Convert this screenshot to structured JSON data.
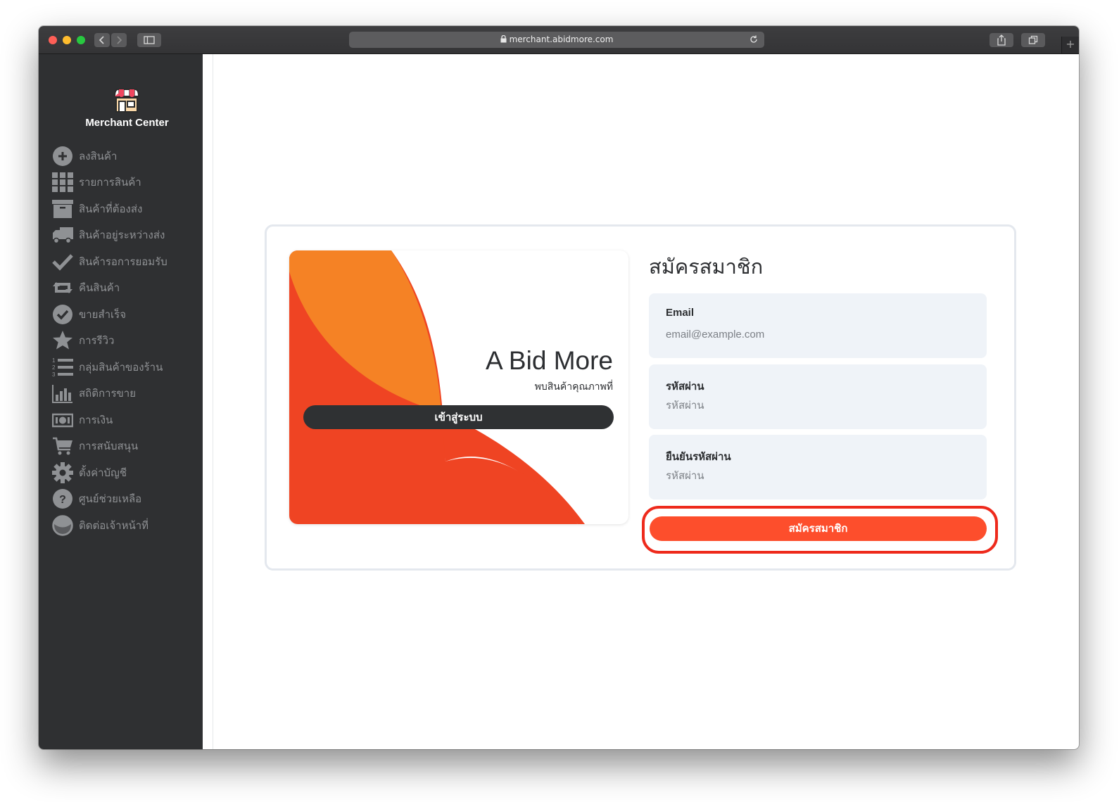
{
  "browser": {
    "url": "merchant.abidmore.com"
  },
  "sidebar": {
    "brand": "Merchant Center",
    "items": [
      {
        "label": "ลงสินค้า",
        "icon": "add-circle-icon"
      },
      {
        "label": "รายการสินค้า",
        "icon": "grid-icon"
      },
      {
        "label": "สินค้าที่ต้องส่ง",
        "icon": "archive-box-icon"
      },
      {
        "label": "สินค้าอยู่ระหว่างส่ง",
        "icon": "truck-icon"
      },
      {
        "label": "สินค้ารอการยอมรับ",
        "icon": "checkmark-icon"
      },
      {
        "label": "คืนสินค้า",
        "icon": "return-arrows-icon"
      },
      {
        "label": "ขายสำเร็จ",
        "icon": "check-circle-icon"
      },
      {
        "label": "การรีวิว",
        "icon": "star-icon"
      },
      {
        "label": "กลุ่มสินค้าของร้าน",
        "icon": "numbered-list-icon"
      },
      {
        "label": "สถิติการขาย",
        "icon": "bar-chart-icon"
      },
      {
        "label": "การเงิน",
        "icon": "money-icon"
      },
      {
        "label": "การสนับสนุน",
        "icon": "cart-icon"
      },
      {
        "label": "ตั้งค่าบัญชี",
        "icon": "gear-icon"
      },
      {
        "label": "ศูนย์ช่วยเหลือ",
        "icon": "help-icon"
      },
      {
        "label": "ติดต่อเจ้าหน้าที่",
        "icon": "chat-icon"
      }
    ]
  },
  "promo": {
    "title": "A Bid More",
    "subtitle": "พบสินค้าคุณภาพที่",
    "login_button": "เข้าสู่ระบบ"
  },
  "form": {
    "title": "สมัครสมาชิก",
    "email_label": "Email",
    "email_placeholder": "email@example.com",
    "password_label": "รหัสผ่าน",
    "password_placeholder": "รหัสผ่าน",
    "confirm_label": "ยืนยันรหัสผ่าน",
    "confirm_placeholder": "รหัสผ่าน",
    "submit_button": "สมัครสมาชิก"
  },
  "colors": {
    "accent": "#fd4e2c",
    "promo_orange": "#f58225",
    "promo_red": "#ef4423",
    "sidebar_bg": "#2f3032"
  }
}
